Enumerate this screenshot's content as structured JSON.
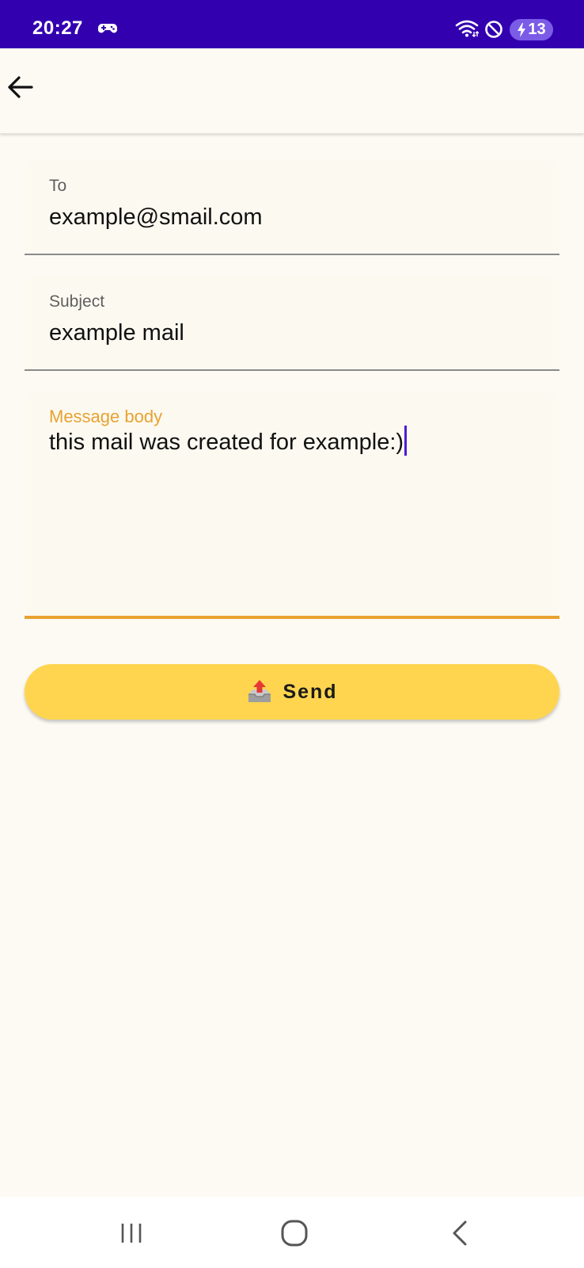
{
  "status_bar": {
    "time": "20:27",
    "battery_level": "13",
    "icons": [
      "game-controller-icon",
      "wifi-icon",
      "do-not-disturb-icon",
      "charging-bolt-icon"
    ],
    "background_color": "#3300b0"
  },
  "app_bar": {
    "back_icon": "arrow-left-icon"
  },
  "form": {
    "to": {
      "label": "To",
      "value": "example@smail.com"
    },
    "subject": {
      "label": "Subject",
      "value": "example mail"
    },
    "body": {
      "label": "Message body",
      "value": "this mail was created for example:)",
      "focused": true,
      "accent_color": "#e8a230"
    }
  },
  "send_button": {
    "icon": "outbox-tray-icon",
    "label": "Send",
    "color": "#ffd54f"
  },
  "nav_bar": {
    "icons": [
      "recents-icon",
      "home-icon",
      "back-chevron-icon"
    ]
  }
}
